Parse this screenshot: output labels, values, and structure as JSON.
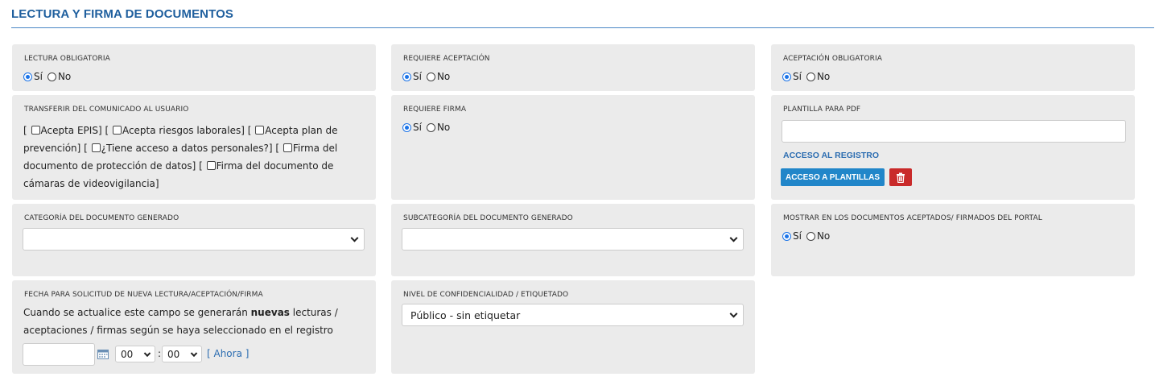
{
  "section": {
    "title": "LECTURA Y FIRMA DE DOCUMENTOS"
  },
  "radio": {
    "yes": "Sí",
    "no": "No"
  },
  "lectura": {
    "label": "LECTURA OBLIGATORIA",
    "value": "Sí"
  },
  "requiere_aceptacion": {
    "label": "REQUIERE ACEPTACIÓN",
    "value": "Sí"
  },
  "aceptacion_obligatoria": {
    "label": "ACEPTACIÓN OBLIGATORIA",
    "value": "Sí"
  },
  "transferir": {
    "label": "TRANSFERIR DEL COMUNICADO AL USUARIO",
    "options": [
      "Acepta EPIS",
      "Acepta riesgos laborales",
      "Acepta plan de prevención",
      "¿Tiene acceso a datos personales?",
      "Firma del documento de protección de datos",
      "Firma del documento de cámaras de videovigilancia"
    ]
  },
  "requiere_firma": {
    "label": "REQUIERE FIRMA",
    "value": "Sí"
  },
  "plantilla": {
    "label": "PLANTILLA PARA PDF",
    "value": "",
    "registro_link": "ACCESO AL REGISTRO",
    "plantillas_button": "ACCESO A PLANTILLAS"
  },
  "categoria": {
    "label": "CATEGORÍA DEL DOCUMENTO GENERADO",
    "value": ""
  },
  "subcategoria": {
    "label": "SUBCATEGORÍA DEL DOCUMENTO GENERADO",
    "value": ""
  },
  "mostrar": {
    "label": "MOSTRAR EN LOS DOCUMENTOS ACEPTADOS/ FIRMADOS DEL PORTAL",
    "value": "Sí"
  },
  "fecha": {
    "label": "FECHA PARA SOLICITUD DE NUEVA LECTURA/ACEPTACIÓN/FIRMA",
    "text_before": "Cuando se actualice este campo se generarán ",
    "text_bold": "nuevas",
    "text_after": " lecturas / aceptaciones / firmas según se haya seleccionado en el registro",
    "date_value": "",
    "hour": "00",
    "minute": "00",
    "now_link": "[ Ahora ]"
  },
  "nivel": {
    "label": "NIVEL DE CONFIDENCIALIDAD / ETIQUETADO",
    "value": "Público - sin etiquetar"
  },
  "colors": {
    "accent": "#1f5f9e",
    "button_primary": "#2186c9",
    "button_danger": "#c92a2a",
    "card_bg": "#ebebeb"
  },
  "icons": {
    "trash": "trash-icon",
    "calendar": "calendar-icon",
    "chevron": "chevron-down-icon"
  }
}
